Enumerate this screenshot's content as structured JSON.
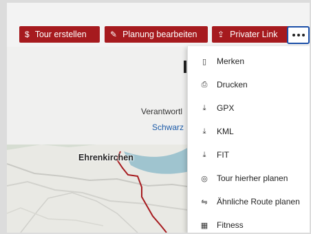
{
  "toolbar": {
    "buttons": [
      {
        "label": "Tour erstellen",
        "icon": "route-icon"
      },
      {
        "label": "Planung bearbeiten",
        "icon": "edit-icon"
      },
      {
        "label": "Privater Link",
        "icon": "share-icon"
      }
    ],
    "more_icon": "more-dots-icon"
  },
  "content": {
    "info_text": "Verantwortl",
    "info_link": "Schwarz"
  },
  "map": {
    "place_label": "Ehrenkirchen",
    "route_color": "#a61a1e",
    "water_color": "#9fc4cf"
  },
  "menu": {
    "items": [
      {
        "label": "Merken",
        "icon": "bookmark-icon"
      },
      {
        "label": "Drucken",
        "icon": "printer-icon"
      },
      {
        "label": "GPX",
        "icon": "download-icon"
      },
      {
        "label": "KML",
        "icon": "download-icon"
      },
      {
        "label": "FIT",
        "icon": "download-icon"
      },
      {
        "label": "Tour hierher planen",
        "icon": "globe-icon"
      },
      {
        "label": "Ähnliche Route planen",
        "icon": "route-icon"
      },
      {
        "label": "Fitness",
        "icon": "calculator-icon"
      }
    ]
  },
  "colors": {
    "brand_red": "#a61a1e",
    "focus_blue": "#1b4fa8",
    "link_blue": "#1b5aa8"
  }
}
